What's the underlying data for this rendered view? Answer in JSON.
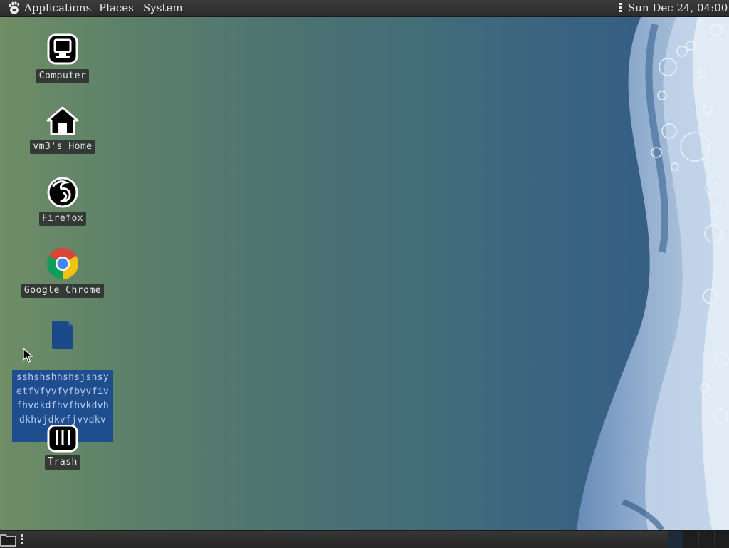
{
  "top_panel": {
    "menus": {
      "applications": "Applications",
      "places": "Places",
      "system": "System"
    },
    "clock": "Sun Dec 24, 04:00"
  },
  "desktop": {
    "icons": {
      "computer": {
        "label": "Computer",
        "icon": "computer-icon"
      },
      "home": {
        "label": "vm3's Home",
        "icon": "home-icon"
      },
      "firefox": {
        "label": "Firefox",
        "icon": "firefox-icon"
      },
      "chrome": {
        "label": "Google Chrome",
        "icon": "chrome-icon"
      },
      "file": {
        "label": "sshshshhshsjshsyetfvfyvfyfbyvfivfhvdkdfhvfhvkdvhdkhvjdkvfjvvdkv",
        "icon": "document-icon",
        "selected": true
      },
      "trash": {
        "label": "Trash",
        "icon": "trash-icon"
      }
    }
  },
  "bottom_panel": {
    "show_desktop_icon": "show-desktop-icon"
  },
  "colors": {
    "panel": "#2e2e2e",
    "selection": "#1f4e8f",
    "label_bg": "#282828",
    "chrome_red": "#db4437",
    "chrome_yellow": "#f4c20d",
    "chrome_green": "#0f9d58",
    "chrome_blue": "#4285f4"
  }
}
